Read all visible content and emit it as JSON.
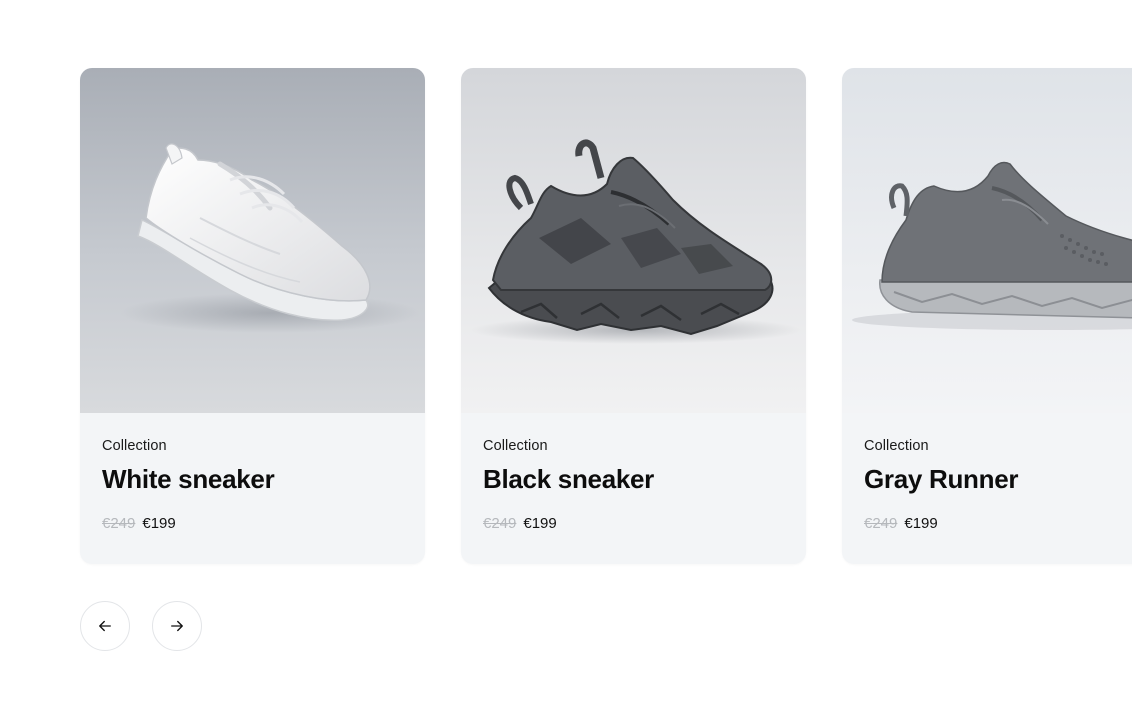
{
  "products": [
    {
      "collection": "Collection",
      "title": "White sneaker",
      "old_price": "€249",
      "price": "€199",
      "image_icon": "white-sneaker-image"
    },
    {
      "collection": "Collection",
      "title": "Black sneaker",
      "old_price": "€249",
      "price": "€199",
      "image_icon": "black-sneaker-image"
    },
    {
      "collection": "Collection",
      "title": "Gray Runner",
      "old_price": "€249",
      "price": "€199",
      "image_icon": "gray-runner-image"
    }
  ],
  "navigation": {
    "prev_icon": "arrow-left-icon",
    "next_icon": "arrow-right-icon"
  },
  "colors": {
    "card_background": "#f3f5f7",
    "old_price": "#b5b8bc",
    "title": "#0d0d0d"
  }
}
